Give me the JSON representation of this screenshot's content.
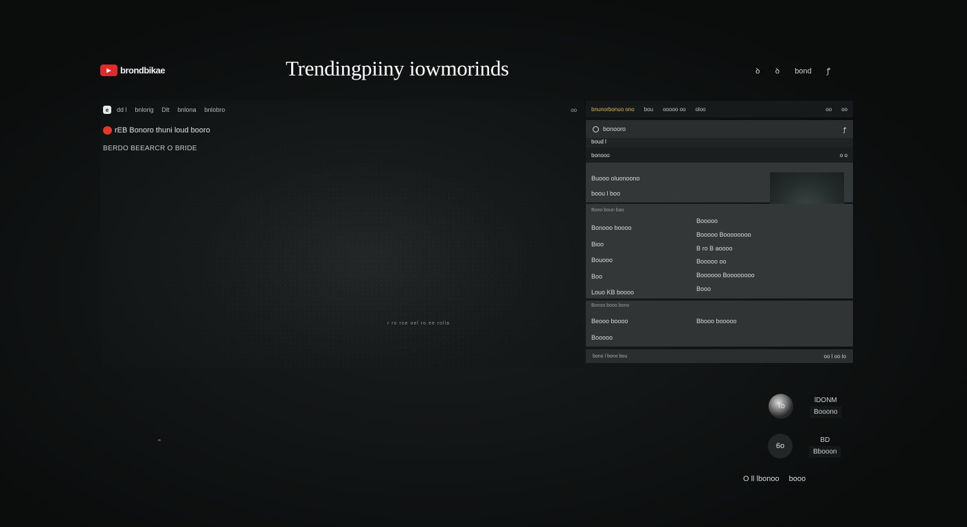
{
  "header": {
    "brand": "brondbikae",
    "title": "Trendingpiiny iowmorinds",
    "top_icons": [
      "ꝺ",
      "ꝺ",
      "bond",
      "ꝭ"
    ]
  },
  "player": {
    "tabs": [
      "dd  l",
      "bnlorig",
      "Dlt",
      "bnlona",
      "bnlobro"
    ],
    "controls": "oo",
    "line1": "rEB Bonoro thuni loud booro",
    "line2": "BERDO BEEARCR O  BRIDE",
    "caption": "r ro roe oel ro ee rolla"
  },
  "panel": {
    "head": [
      "bnunorbonuo ono",
      "bou",
      "ooooo oo",
      "oloo",
      "oo",
      "oo"
    ],
    "search": "bonooro",
    "search_right": "ꝭ",
    "sub1": "boud l",
    "sub2_left": "bonooo",
    "sub2_right": "o o",
    "card_lines": [
      "Buooo oluonoono",
      "boou l boo"
    ],
    "grid_caption": "Bono boun bao",
    "grid_left": [
      "Bonooo boooo",
      "Bioo",
      "Bouooo",
      "Boo",
      "Louo KB boooo"
    ],
    "grid_right": [
      "Booooo",
      "Booooo Boooooooo",
      "B ro B aoooo",
      "Booooo oo",
      "Boooooo Boooooooo",
      "Booo"
    ],
    "info_caption": "Bonoo booo bono",
    "info_a": "Beooo boooo",
    "info_b": "Bbooo booooo",
    "info_c": "Booooo",
    "footer_left": "bono l bono bou",
    "footer_right": "oo  l  oo  lo"
  },
  "channels": [
    {
      "avatar_text": "To",
      "label_top": "lDONM",
      "label_bottom": "Booono"
    },
    {
      "avatar_text": "6o",
      "label_top": "BD",
      "label_bottom": "Bbooon"
    }
  ],
  "bottom": {
    "left": "O  ll  lbonoo",
    "right": "booo"
  }
}
